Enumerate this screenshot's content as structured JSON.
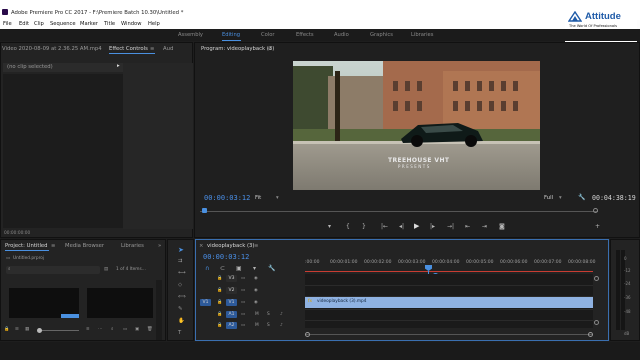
{
  "window": {
    "title": "Adobe Premiere Pro CC 2017 - F:\\Premiere Batch 10.30\\Untitled *"
  },
  "menu": [
    "File",
    "Edit",
    "Clip",
    "Sequence",
    "Marker",
    "Title",
    "Window",
    "Help"
  ],
  "watermark": {
    "name": "Attitude",
    "tagline1": "The World Of Professionals",
    "tagline2": "An ISO 9001 : 2008 Company"
  },
  "workspaces": [
    "Assembly",
    "Editing",
    "Color",
    "Effects",
    "Audio",
    "Graphics",
    "Libraries"
  ],
  "workspace_active": "Editing",
  "source_panel": {
    "tabs": [
      "Video 2020-08-09 at 2.36.25 AM.mp4",
      "Effect Controls",
      "Aud"
    ],
    "no_clip": "(no clip selected)",
    "timecode": "00:00:00:00"
  },
  "program_monitor": {
    "title": "Program: videoplayback (3)",
    "timecode": "00:00:03:12",
    "fit": "Fit",
    "quality": "Full",
    "duration": "00:04:38:19",
    "overlay_line1": "TREEHOUSE VHT",
    "overlay_line2": "PRESENTS"
  },
  "project_panel": {
    "tabs": [
      "Project: Untitled",
      "Media Browser",
      "Libraries"
    ],
    "file": "Untitled.prproj",
    "count": "1 of 4 Items..."
  },
  "timeline": {
    "tab": "videoplayback (3)",
    "timecode": "00:00:03:12",
    "ruler": [
      ":00:00",
      "00:00:01:00",
      "00:00:02:00",
      "00:00:03:00",
      "00:00:04:00",
      "00:00:05:00",
      "00:00:06:00",
      "00:00:07:00",
      "00:00:08:00"
    ],
    "tracks": [
      {
        "id": "V3",
        "patch": ""
      },
      {
        "id": "V2",
        "patch": ""
      },
      {
        "id": "V1",
        "patch": "V1"
      },
      {
        "id": "A1",
        "patch": "A1"
      },
      {
        "id": "A2",
        "patch": "A2"
      }
    ],
    "clip": "videoplayback (3).mp4",
    "track_mute": "M",
    "track_solo": "S"
  },
  "meter": {
    "scale": [
      "0",
      "-12",
      "-24",
      "-36",
      "-48",
      "dB"
    ]
  },
  "colors": {
    "accent": "#4a90e0",
    "clip": "#8fb2e2",
    "timecode": "#4a8fe7"
  }
}
